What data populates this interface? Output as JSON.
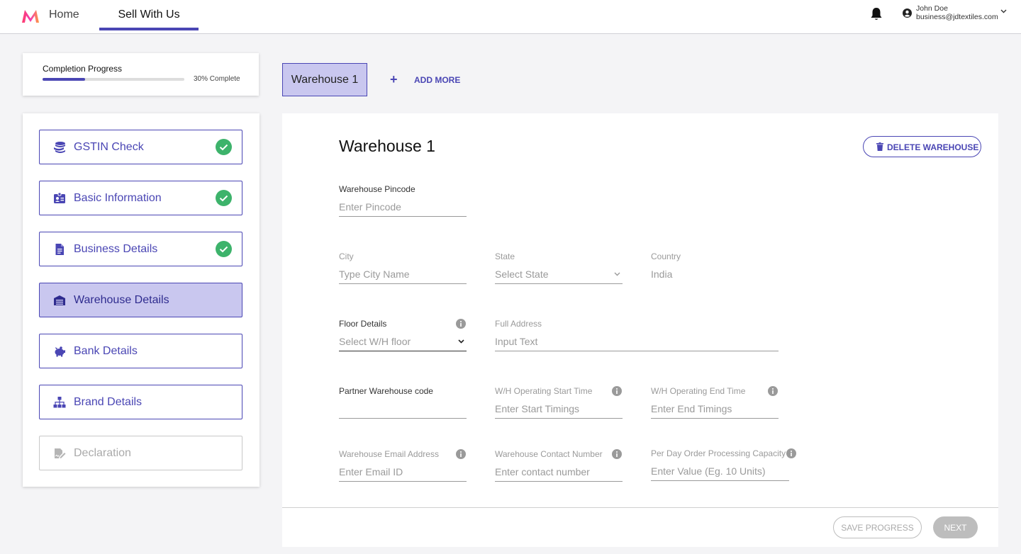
{
  "header": {
    "nav": [
      {
        "label": "Home"
      },
      {
        "label": "Sell With Us"
      }
    ],
    "user": {
      "name": "John Doe",
      "email": "business@jdtextiles.com"
    }
  },
  "progress": {
    "title": "Completion Progress",
    "percent": 30,
    "label": "30% Complete"
  },
  "steps": [
    {
      "label": "GSTIN Check",
      "icon": "coins-stack-icon",
      "status": "complete"
    },
    {
      "label": "Basic Information",
      "icon": "id-card-icon",
      "status": "complete"
    },
    {
      "label": "Business Details",
      "icon": "document-icon",
      "status": "complete"
    },
    {
      "label": "Warehouse Details",
      "icon": "warehouse-icon",
      "status": "active"
    },
    {
      "label": "Bank Details",
      "icon": "piggy-bank-icon",
      "status": "pending"
    },
    {
      "label": "Brand Details",
      "icon": "org-chart-icon",
      "status": "pending"
    },
    {
      "label": "Declaration",
      "icon": "signature-icon",
      "status": "disabled"
    }
  ],
  "warehouse_tabs": {
    "tabs": [
      "Warehouse 1"
    ],
    "add_more": "ADD MORE"
  },
  "form": {
    "title": "Warehouse 1",
    "delete_label": "DELETE WAREHOUSE",
    "pincode": {
      "label": "Warehouse Pincode",
      "placeholder": "Enter Pincode"
    },
    "city": {
      "label": "City",
      "placeholder": "Type City Name"
    },
    "state": {
      "label": "State",
      "placeholder": "Select State"
    },
    "country": {
      "label": "Country",
      "value": "India"
    },
    "floor": {
      "label": "Floor Details",
      "placeholder": "Select W/H floor"
    },
    "address": {
      "label": "Full Address",
      "placeholder": "Input Text"
    },
    "partner_code": {
      "label": "Partner Warehouse code",
      "placeholder": ""
    },
    "start_time": {
      "label": "W/H Operating Start Time",
      "placeholder": "Enter Start Timings"
    },
    "end_time": {
      "label": "W/H Operating End Time",
      "placeholder": "Enter End Timings"
    },
    "email": {
      "label": "Warehouse Email Address",
      "placeholder": "Enter Email ID"
    },
    "contact": {
      "label": "Warehouse Contact Number",
      "placeholder": "Enter contact number"
    },
    "capacity": {
      "label": "Per Day Order Processing Capacity",
      "placeholder": "Enter Value (Eg. 10 Units)"
    },
    "save_label": "SAVE PROGRESS",
    "next_label": "NEXT"
  },
  "colors": {
    "accent": "#4a46b4",
    "active_bg": "#c9c7ef",
    "success": "#3db36b"
  }
}
